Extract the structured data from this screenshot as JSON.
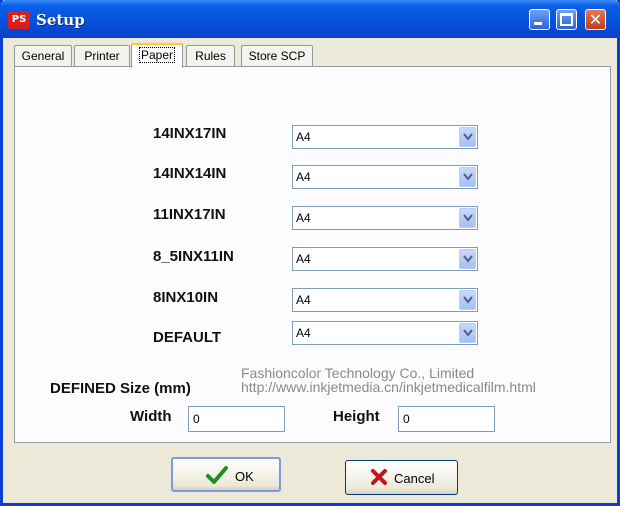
{
  "window": {
    "title": "Setup",
    "icon_text": "PS",
    "accent_color": "#0a5fe8"
  },
  "title_buttons": {
    "close_glyph": "✕"
  },
  "tabs": [
    {
      "label": "General",
      "active": false
    },
    {
      "label": "Printer",
      "active": false
    },
    {
      "label": "Paper",
      "active": true
    },
    {
      "label": "Rules",
      "active": false
    },
    {
      "label": "Store SCP",
      "active": false
    }
  ],
  "paper_mappings": [
    {
      "label": "14INX17IN",
      "value": "A4"
    },
    {
      "label": "14INX14IN",
      "value": "A4"
    },
    {
      "label": "11INX17IN",
      "value": "A4"
    },
    {
      "label": "8_5INX11IN",
      "value": "A4"
    },
    {
      "label": "8INX10IN",
      "value": "A4"
    },
    {
      "label": "DEFAULT",
      "value": "A4"
    }
  ],
  "watermark": {
    "line1": "Fashioncolor Technology Co., Limited",
    "line2": "http://www.inkjetmedia.cn/inkjetmedicalfilm.html"
  },
  "defined_size": {
    "label": "DEFINED Size (mm)",
    "width_label": "Width",
    "width_value": "0",
    "height_label": "Height",
    "height_value": "0"
  },
  "buttons": {
    "ok_label": "OK",
    "cancel_label": "Cancel"
  }
}
